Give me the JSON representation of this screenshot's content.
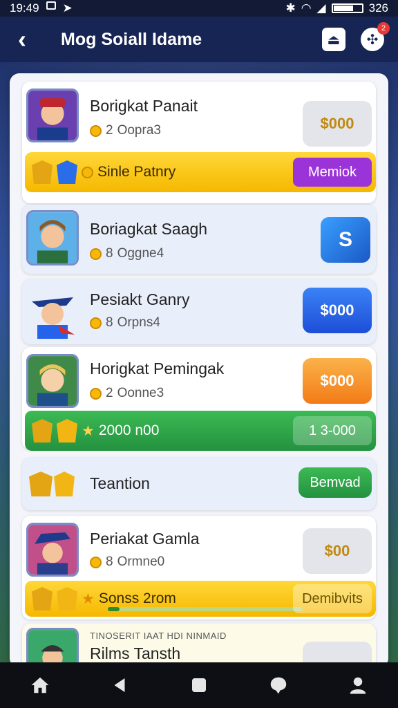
{
  "status": {
    "time": "19:49",
    "right_text": "326"
  },
  "header": {
    "title": "Mog Soiall Idame",
    "notification_count": "2"
  },
  "cards": [
    {
      "name": "Borigkat Panait",
      "count": "2",
      "meta": "Oopra3",
      "action": "$000"
    },
    {
      "name": "Boriagkat Saagh",
      "count": "8",
      "meta": "Oggne4"
    },
    {
      "name": "Pesiakt Ganry",
      "count": "8",
      "meta": "Orpns4",
      "action": "$000"
    },
    {
      "name": "Horigkat Pemingak",
      "count": "2",
      "meta": "Oonne3",
      "action": "$000"
    },
    {
      "name": "Teantion",
      "action": "Bemvad"
    },
    {
      "name": "Periakat Gamla",
      "count": "8",
      "meta": "Ormne0",
      "action": "$00"
    },
    {
      "ad": "TINOSERIT IAAT HDI NINMAID",
      "name": "Rilms Tansth"
    }
  ],
  "rewards": [
    {
      "label": "Sinle Patnry",
      "button": "Memiok"
    },
    {
      "label": "2000 n00",
      "button": "1 3-000"
    },
    {
      "label": "Sonss 2rom",
      "button": "Demibvits",
      "progress": 0.06
    }
  ],
  "colors": {
    "header": "#172554",
    "purple": "#9b34d8",
    "green": "#249140",
    "yellow": "#f5b800"
  }
}
